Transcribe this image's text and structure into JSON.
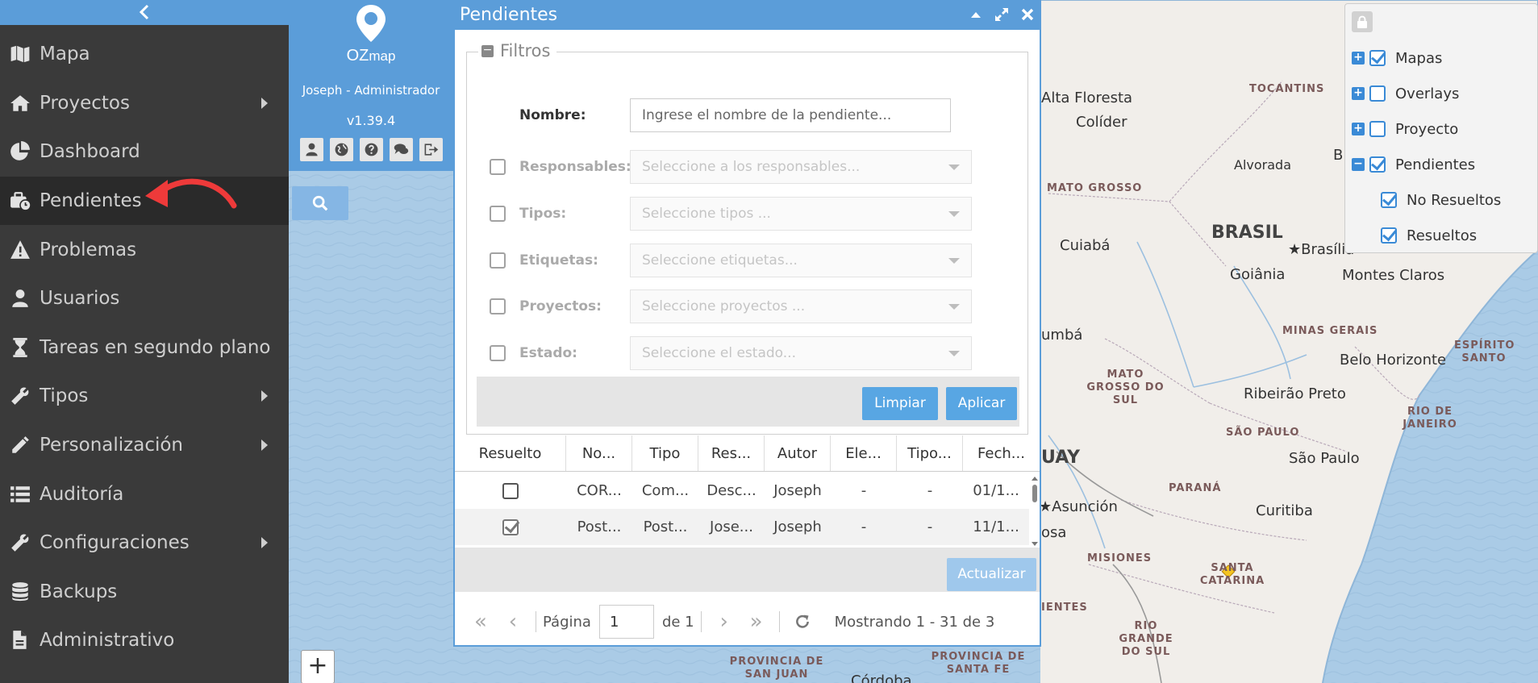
{
  "sidebar": {
    "collapse_icon": "chevron-left-icon",
    "items": [
      {
        "label": "Mapa",
        "icon": "map-icon",
        "has_submenu": false
      },
      {
        "label": "Proyectos",
        "icon": "home-icon",
        "has_submenu": true
      },
      {
        "label": "Dashboard",
        "icon": "pie-chart-icon",
        "has_submenu": false
      },
      {
        "label": "Pendientes",
        "icon": "briefcase-clock-icon",
        "has_submenu": false,
        "active": true
      },
      {
        "label": "Problemas",
        "icon": "warning-icon",
        "has_submenu": false
      },
      {
        "label": "Usuarios",
        "icon": "user-icon",
        "has_submenu": false
      },
      {
        "label": "Tareas en segundo plano",
        "icon": "hourglass-icon",
        "has_submenu": false
      },
      {
        "label": "Tipos",
        "icon": "wrench-icon",
        "has_submenu": true
      },
      {
        "label": "Personalización",
        "icon": "pencil-icon",
        "has_submenu": true
      },
      {
        "label": "Auditoría",
        "icon": "list-icon",
        "has_submenu": false
      },
      {
        "label": "Configuraciones",
        "icon": "wrench-icon",
        "has_submenu": true
      },
      {
        "label": "Backups",
        "icon": "database-icon",
        "has_submenu": false
      },
      {
        "label": "Administrativo",
        "icon": "document-icon",
        "has_submenu": false
      }
    ]
  },
  "user_panel": {
    "logo_text_bold": "OZ",
    "logo_text_light": "map",
    "user": "Joseph - Administrador",
    "version": "v1.39.4",
    "tools": [
      "user-icon",
      "globe-icon",
      "help-icon",
      "chat-icon",
      "logout-icon"
    ]
  },
  "map": {
    "zoom_in": "+",
    "cities": [
      {
        "name": "Alta Floresta"
      },
      {
        "name": "Colíder"
      },
      {
        "name": "Alvorada"
      },
      {
        "name": "B"
      },
      {
        "name": "Cuiabá"
      },
      {
        "name": "Brasília"
      },
      {
        "name": "Goiânia"
      },
      {
        "name": "Montes Claros"
      },
      {
        "name": "umbá"
      },
      {
        "name": "Belo Horizonte"
      },
      {
        "name": "Ribeirão Preto"
      },
      {
        "name": "São Paulo"
      },
      {
        "name": "Asunción"
      },
      {
        "name": "osa"
      },
      {
        "name": "Curitiba"
      },
      {
        "name": "Córdoba"
      }
    ],
    "states": [
      "TOCANTINS",
      "MATO GROSSO",
      "MINAS GERAIS",
      "ESPÍRITO SANTO",
      "MATO GROSSO DO SUL",
      "RIO DE JANEIRO",
      "SÃO PAULO",
      "PARANÁ",
      "MISIONES",
      "SANTA CATARINA",
      "IENTES",
      "RIO GRANDE DO SUL",
      "PROVINCIA DE SAN JUAN",
      "PROVINCIA DE SANTA FE"
    ],
    "countries": [
      "BRASIL",
      "UAY"
    ]
  },
  "layers": {
    "lock_icon": "lock-icon",
    "items": [
      {
        "label": "Mapas",
        "expander": "+",
        "checked": true
      },
      {
        "label": "Overlays",
        "expander": "+",
        "checked": false
      },
      {
        "label": "Proyecto",
        "expander": "+",
        "checked": false
      },
      {
        "label": "Pendientes",
        "expander": "−",
        "checked": true
      },
      {
        "label": "No Resueltos",
        "expander": "",
        "checked": true
      },
      {
        "label": "Resueltos",
        "expander": "",
        "checked": true
      }
    ]
  },
  "window": {
    "title": "Pendientes",
    "filters": {
      "legend": "Filtros",
      "nombre_label": "Nombre:",
      "nombre_placeholder": "Ingrese el nombre de la pendiente...",
      "rows": [
        {
          "label": "Responsables:",
          "placeholder": "Seleccione a los responsables..."
        },
        {
          "label": "Tipos:",
          "placeholder": "Seleccione tipos ..."
        },
        {
          "label": "Etiquetas:",
          "placeholder": "Seleccione etiquetas..."
        },
        {
          "label": "Proyectos:",
          "placeholder": "Seleccione proyectos ..."
        },
        {
          "label": "Estado:",
          "placeholder": "Seleccione el estado..."
        }
      ],
      "clear_label": "Limpiar",
      "apply_label": "Aplicar"
    },
    "grid": {
      "columns": [
        "Resuelto",
        "No...",
        "Tipo",
        "Res...",
        "Autor",
        "Ele...",
        "Tipo...",
        "Fech..."
      ],
      "rows": [
        {
          "resolved": false,
          "name": "COR...",
          "type": "Com...",
          "res": "Desc...",
          "author": "Joseph",
          "ele": "-",
          "tipo2": "-",
          "date": "01/1..."
        },
        {
          "resolved": true,
          "name": "Post...",
          "type": "Post...",
          "res": "Jose...",
          "author": "Joseph",
          "ele": "-",
          "tipo2": "-",
          "date": "11/1..."
        }
      ]
    },
    "refresh_label": "Actualizar",
    "pager": {
      "page_label": "Página",
      "page_value": "1",
      "of_label": "de 1",
      "summary": "Mostrando 1 - 31 de 3"
    }
  }
}
